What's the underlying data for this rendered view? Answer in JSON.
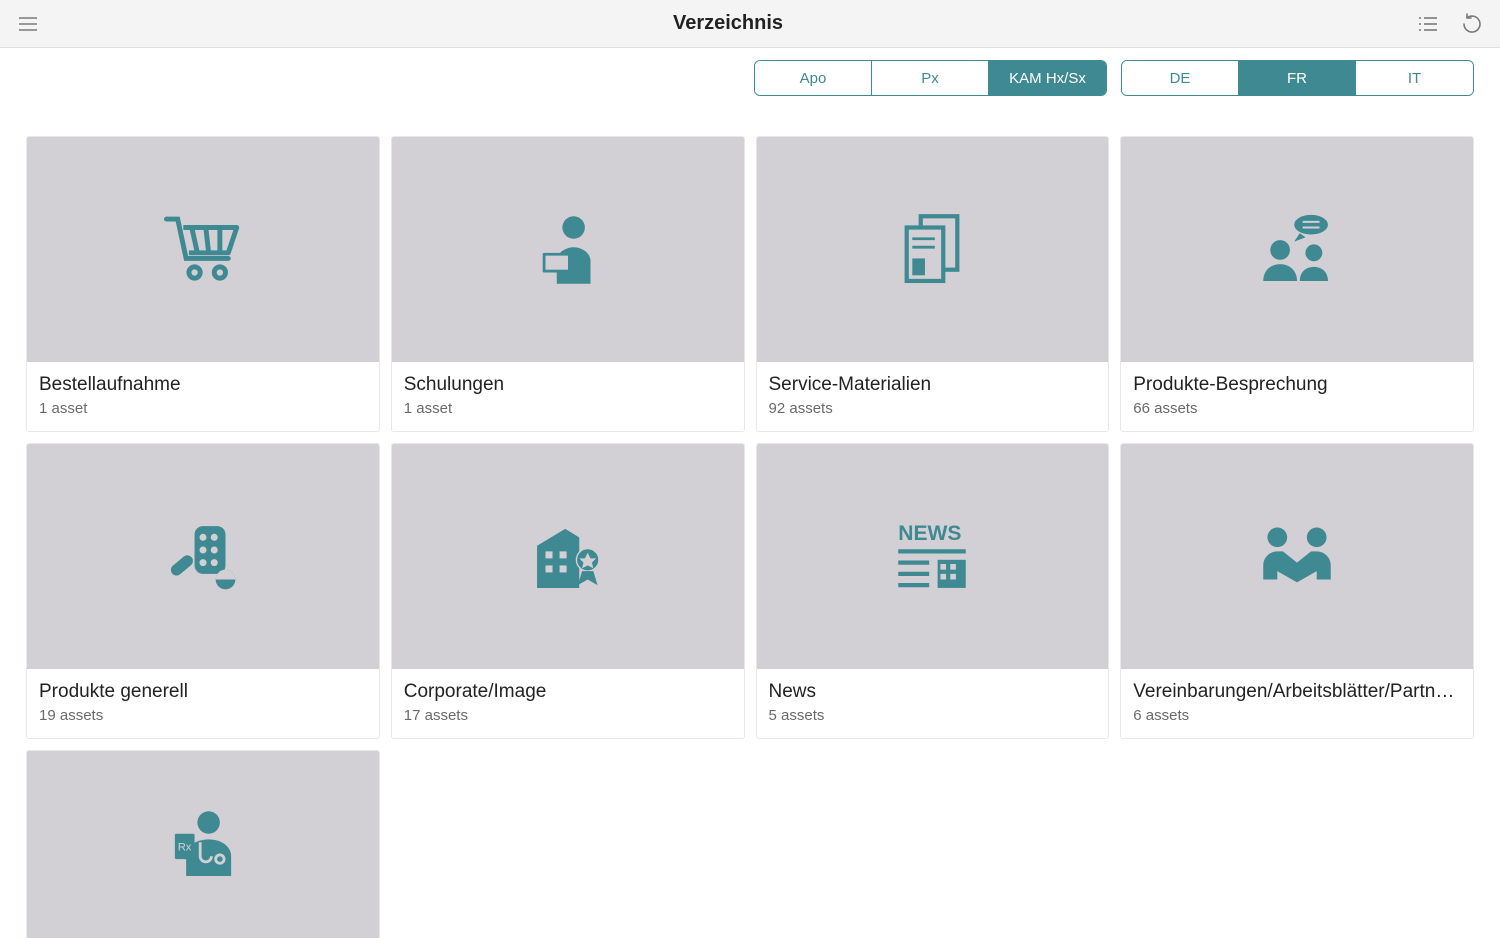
{
  "header": {
    "title": "Verzeichnis"
  },
  "filters": {
    "category": {
      "items": [
        {
          "label": "Apo",
          "active": false
        },
        {
          "label": "Px",
          "active": false
        },
        {
          "label": "KAM Hx/Sx",
          "active": true
        }
      ]
    },
    "language": {
      "items": [
        {
          "label": "DE",
          "active": false
        },
        {
          "label": "FR",
          "active": true
        },
        {
          "label": "IT",
          "active": false
        }
      ]
    }
  },
  "cards": [
    {
      "icon": "cart",
      "title": "Bestellaufnahme",
      "meta": "1 asset"
    },
    {
      "icon": "training",
      "title": "Schulungen",
      "meta": "1 asset"
    },
    {
      "icon": "docs",
      "title": "Service-Materialien",
      "meta": "92 assets"
    },
    {
      "icon": "discuss",
      "title": "Produkte-Besprechung",
      "meta": "66 assets"
    },
    {
      "icon": "pills",
      "title": "Produkte generell",
      "meta": "19 assets"
    },
    {
      "icon": "corporate",
      "title": "Corporate/Image",
      "meta": "17 assets"
    },
    {
      "icon": "news",
      "title": "News",
      "meta": "5 assets"
    },
    {
      "icon": "handshake",
      "title": "Vereinbarungen/Arbeitsblätter/Partners...",
      "meta": "6 assets"
    },
    {
      "icon": "doctor",
      "title": "",
      "meta": ""
    }
  ],
  "colors": {
    "accent": "#3f8992",
    "thumbBg": "#d2d0d4"
  }
}
